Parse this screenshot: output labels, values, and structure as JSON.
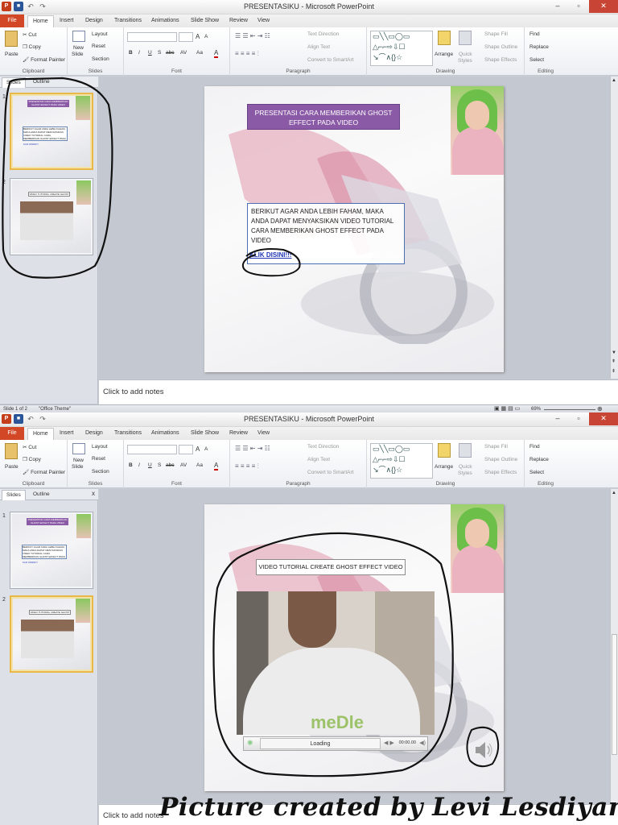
{
  "window": {
    "title": "PRESENTASIKU - Microsoft PowerPoint",
    "app_letter": "P",
    "controls": {
      "minimize": "‒",
      "maximize": "▫",
      "close": "✕"
    }
  },
  "tabs": [
    "File",
    "Home",
    "Insert",
    "Design",
    "Transitions",
    "Animations",
    "Slide Show",
    "Review",
    "View"
  ],
  "ribbon": {
    "clipboard": {
      "label": "Clipboard",
      "paste": "Paste",
      "cut": "Cut",
      "copy": "Copy",
      "format_painter": "Format Painter"
    },
    "slides": {
      "label": "Slides",
      "new_slide": "New",
      "new_slide_2": "Slide",
      "layout": "Layout",
      "reset": "Reset",
      "section": "Section"
    },
    "font": {
      "label": "Font",
      "bold": "B",
      "italic": "I",
      "underline": "U",
      "strike": "S",
      "abc": "abc",
      "spacing": "AV",
      "case": "Aa",
      "color": "A",
      "grow": "A",
      "shrink": "A"
    },
    "paragraph": {
      "label": "Paragraph",
      "text_direction": "Text Direction",
      "align_text": "Align Text",
      "smartart": "Convert to SmartArt"
    },
    "drawing": {
      "label": "Drawing",
      "arrange": "Arrange",
      "quick_styles": "Quick",
      "quick_styles_2": "Styles",
      "shape_fill": "Shape Fill",
      "shape_outline": "Shape Outline",
      "shape_effects": "Shape Effects"
    },
    "editing": {
      "label": "Editing",
      "find": "Find",
      "replace": "Replace",
      "select": "Select"
    }
  },
  "panel": {
    "tab_slides": "Slides",
    "tab_outline": "Outline",
    "close": "x",
    "num1": "1",
    "num2": "2"
  },
  "thumb1": {
    "title": "PRESENTASI CARA MEMBERIKAN GHOST EFFECT PADA VIDEO",
    "body": "BERIKUT AGAR ANDA LEBIH FAHAM, MAKA ANDA DAPAT MENYAKSIKAN VIDEO TUTORIAL CARA MEMBERIKAN GHOST EFFECT PADA VIDEO",
    "link": "KLIK DISINI!!!"
  },
  "thumb2": {
    "title": "VIDEO TUTORIAL CREATE GHOST EFFECT VIDEO"
  },
  "slide1": {
    "title": "PRESENTASI CARA MEMBERIKAN GHOST EFFECT PADA VIDEO",
    "body": "BERIKUT AGAR ANDA LEBIH FAHAM, MAKA ANDA DAPAT MENYAKSIKAN VIDEO TUTORIAL CARA MEMBERIKAN GHOST EFFECT PADA VIDEO",
    "link": "KLIK DISINI!!!"
  },
  "slide2": {
    "title": "VIDEO TUTORIAL CREATE GHOST EFFECT VIDEO",
    "video_status": "Loading",
    "video_time": "00:00.00",
    "shirt_logo": "meDle"
  },
  "notes_placeholder": "Click to add notes",
  "status": {
    "slide_count": "Slide 1 of 2",
    "theme": "\"Office Theme\"",
    "zoom": "69%"
  },
  "scroll": {
    "up": "▲",
    "down": "▼",
    "prev": "⇞",
    "next": "⇟"
  },
  "watermark": "Picture created by Levi Lesdiyanti",
  "colors": {
    "file_tab": "#d24726",
    "title_box": "#8a5aa6",
    "link": "#2136b5",
    "selection": "#e8b949"
  }
}
